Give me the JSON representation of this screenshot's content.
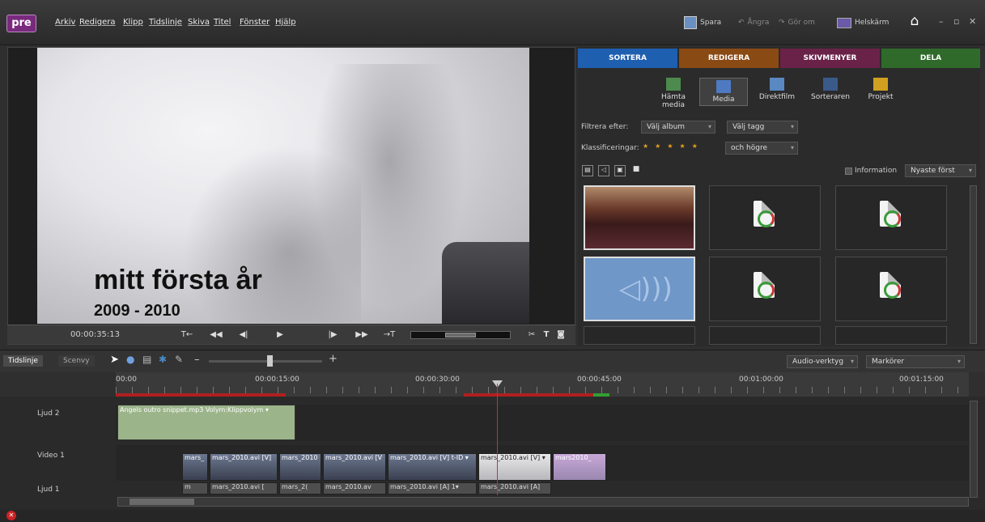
{
  "app": {
    "logo": "pre"
  },
  "menu": [
    "Arkiv",
    "Redigera",
    "Klipp",
    "Tidslinje",
    "Skiva",
    "Titel",
    "Fönster",
    "Hjälp"
  ],
  "toolbar": {
    "save": "Spara",
    "undo": "Ångra",
    "redo": "Gör om",
    "fullscreen": "Helskärm"
  },
  "preview": {
    "title_line1": "mitt första år",
    "title_line2": "2009 - 2010",
    "timecode": "00:00:35:13"
  },
  "tabs": [
    {
      "label": "SORTERA",
      "color": "#1f5fb0"
    },
    {
      "label": "REDIGERA",
      "color": "#8a4a14"
    },
    {
      "label": "SKIVMENYER",
      "color": "#6a2248"
    },
    {
      "label": "DELA",
      "color": "#2f6a2a"
    }
  ],
  "subtools": [
    "Hämta media",
    "Media",
    "Direktfilm",
    "Sorteraren",
    "Projekt"
  ],
  "filter": {
    "label": "Filtrera efter:",
    "album": "Välj album",
    "tag": "Välj tagg",
    "rating_label": "Klassificeringar:",
    "rating_mode": "och högre"
  },
  "view": {
    "info": "Information",
    "sort": "Nyaste först"
  },
  "timeline": {
    "tab1": "Tidslinje",
    "tab2": "Scenvy",
    "audio_tool": "Audio-verktyg",
    "markers": "Markörer"
  },
  "ruler": [
    "00:00",
    "00:00:15:00",
    "00:00:30:00",
    "00:00:45:00",
    "00:01:00:00",
    "00:01:15:00"
  ],
  "tracks": {
    "t1": "Ljud 2",
    "t2": "Video 1",
    "t3": "Ljud 1"
  },
  "audio2_clip": "Angels outro snippet.mp3 Volym:Klippvolym ▾",
  "video_clips": [
    "mars_",
    "mars_2010.avi [V]",
    "mars_2010",
    "mars_2010.avi [V",
    "mars_2010.avi [V] t-ID ▾",
    "mars_2010.avi [V] ▾",
    "mars2010_"
  ],
  "audio_clips": [
    "m",
    "mars_2010.avi [",
    "mars_2(",
    "mars_2010.av",
    "mars_2010.avi [A] 1▾",
    "mars_2010.avi [A]"
  ]
}
